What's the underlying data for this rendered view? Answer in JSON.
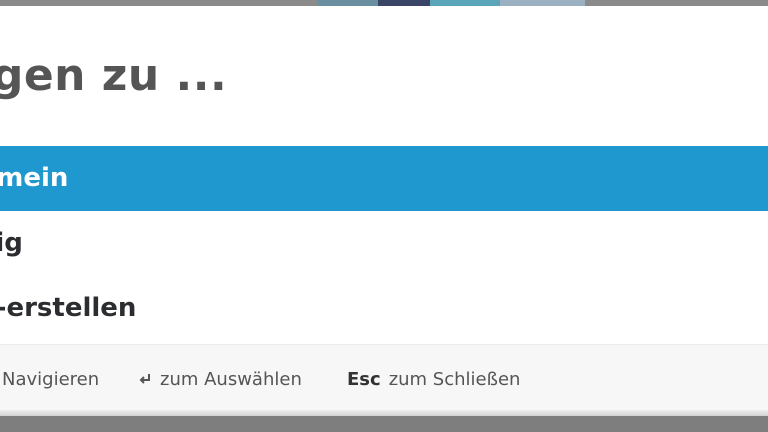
{
  "dialog": {
    "title": "ngen zu ...",
    "options": [
      {
        "label": "gemein",
        "selected": true
      },
      {
        "label": "ällig",
        "selected": false
      },
      {
        "label": "oji-erstellen",
        "selected": false
      }
    ],
    "footer": {
      "navigate_label": "Navigieren",
      "select_icon": "return-icon",
      "select_label": "zum Auswählen",
      "close_key": "Esc",
      "close_label": "zum Schließen"
    }
  },
  "colors": {
    "selected_bg": "#1f97cf",
    "title_text": "#555555",
    "option_text": "#2c2d30",
    "footer_bg": "#f7f7f7"
  }
}
